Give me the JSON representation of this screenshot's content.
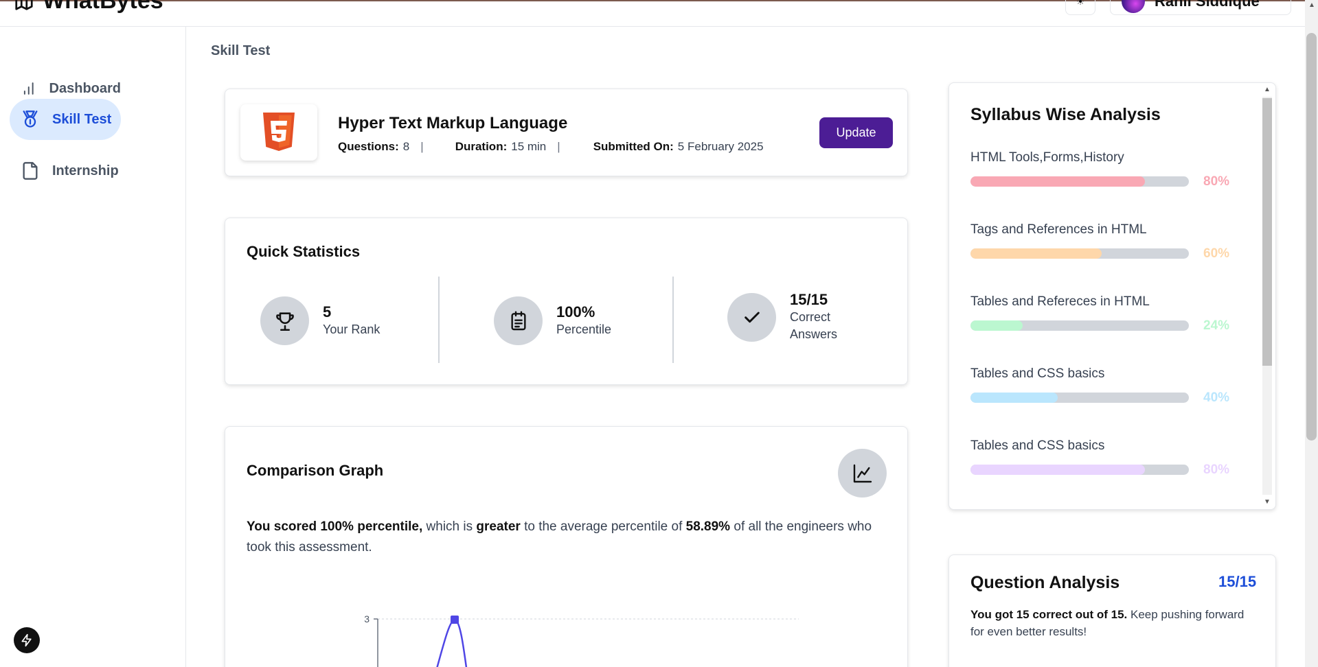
{
  "header": {
    "brand": "WhatBytes",
    "user_name": "Rahil Siddique"
  },
  "sidebar": {
    "items": [
      {
        "label": "Dashboard"
      },
      {
        "label": "Skill Test"
      },
      {
        "label": "Internship"
      }
    ]
  },
  "breadcrumb": "Skill Test",
  "test": {
    "title": "Hyper Text Markup Language",
    "questions_label": "Questions:",
    "questions_value": "8",
    "duration_label": "Duration:",
    "duration_value": "15 min",
    "submitted_label": "Submitted On:",
    "submitted_value": "5 February 2025",
    "separator": "|",
    "update_label": "Update"
  },
  "quick_stats": {
    "title": "Quick Statistics",
    "rank_value": "5",
    "rank_label": "Your Rank",
    "percentile_value": "100%",
    "percentile_label": "Percentile",
    "correct_value": "15/15",
    "correct_label_1": "Correct",
    "correct_label_2": "Answers"
  },
  "comparison": {
    "title": "Comparison Graph",
    "text_bold_1": "You scored 100% percentile,",
    "text_1": " which is ",
    "text_bold_2": "greater",
    "text_2": " to the average percentile of ",
    "text_bold_3": "58.89%",
    "text_3": " of all the engineers who took this assessment."
  },
  "chart_data": {
    "type": "line",
    "y_ticks": [
      "3"
    ],
    "visible_point": {
      "y": 3
    }
  },
  "syllabus": {
    "title": "Syllabus Wise Analysis",
    "items": [
      {
        "name": "HTML Tools,Forms,History",
        "percent": 80,
        "percent_label": "80%",
        "color": "#f9a8b4"
      },
      {
        "name": "Tags and References in HTML",
        "percent": 60,
        "percent_label": "60%",
        "color": "#fed7aa"
      },
      {
        "name": "Tables and Refereces in HTML",
        "percent": 24,
        "percent_label": "24%",
        "color": "#bbf7d0"
      },
      {
        "name": "Tables and CSS basics",
        "percent": 40,
        "percent_label": "40%",
        "color": "#bae6fd"
      },
      {
        "name": "Tables and CSS basics",
        "percent": 80,
        "percent_label": "80%",
        "color": "#e9d5ff"
      }
    ]
  },
  "question_analysis": {
    "title": "Question Analysis",
    "score": "15/15",
    "text_bold": "You got 15 correct out of 15.",
    "text": " Keep pushing forward for even better results!"
  },
  "colors": {
    "accent": "#1d4ed8",
    "update_button": "#4c1d95",
    "chart_line": "#4f46e5"
  }
}
